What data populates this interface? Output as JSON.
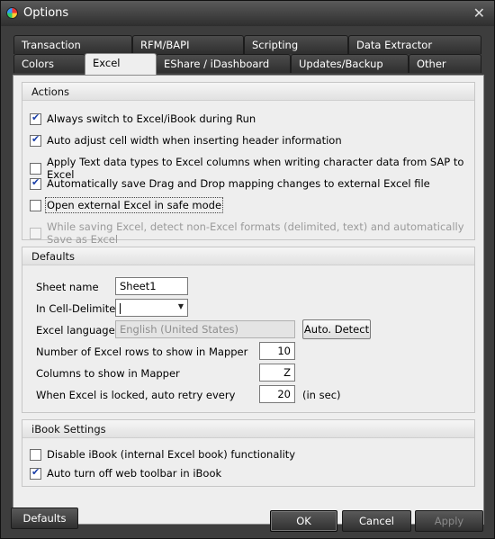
{
  "window": {
    "title": "Options"
  },
  "tabs": {
    "row1": [
      "Transaction",
      "RFM/BAPI",
      "Scripting",
      "Data Extractor"
    ],
    "row2": [
      "Colors",
      "Excel",
      "EShare / iDashboard",
      "Updates/Backup",
      "Other"
    ],
    "active": "Excel"
  },
  "actions": {
    "header": "Actions",
    "items": [
      {
        "label": "Always switch to Excel/iBook during Run",
        "checked": true
      },
      {
        "label": "Auto adjust cell width when inserting header information",
        "checked": true
      },
      {
        "label": "Apply Text data types to Excel columns when writing character data from SAP to Excel",
        "checked": false
      },
      {
        "label": "Automatically save Drag and Drop mapping changes to external Excel file",
        "checked": true
      },
      {
        "label": "Open external Excel in safe mode",
        "checked": false
      },
      {
        "label": "While saving Excel, detect non-Excel formats (delimited, text) and automatically Save as Excel",
        "checked": false,
        "disabled": true
      }
    ]
  },
  "defaults": {
    "header": "Defaults",
    "sheet_name_label": "Sheet name",
    "sheet_name_value": "Sheet1",
    "delimiter_label": "In Cell-Delimiter",
    "delimiter_value": "",
    "language_label": "Excel language",
    "language_value": "English (United States)",
    "auto_detect_label": "Auto. Detect",
    "rows_label": "Number of Excel rows to show in Mapper",
    "rows_value": "10",
    "columns_label": "Columns to show in Mapper",
    "columns_value": "Z",
    "retry_label": "When Excel is locked, auto retry every",
    "retry_value": "20",
    "retry_unit": "(in sec)"
  },
  "ibook": {
    "header": "iBook Settings",
    "items": [
      {
        "label": "Disable iBook (internal Excel book) functionality",
        "checked": false
      },
      {
        "label": "Auto turn off web toolbar in iBook",
        "checked": true
      }
    ]
  },
  "buttons": {
    "defaults": "Defaults",
    "ok": "OK",
    "cancel": "Cancel",
    "apply": "Apply"
  }
}
